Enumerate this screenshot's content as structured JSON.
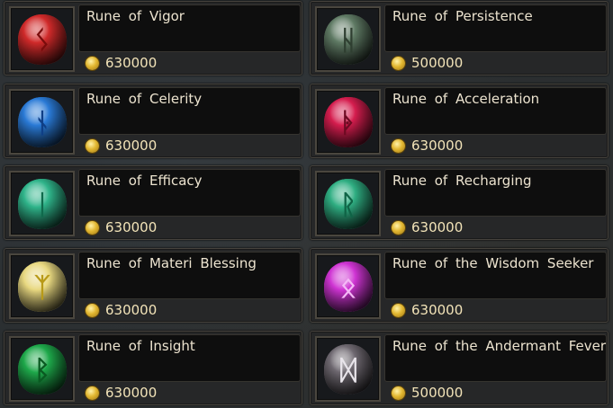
{
  "runes": [
    {
      "name": "Rune of Vigor",
      "price": "630000",
      "color": "#d02a2a",
      "glyph": "ᛊ",
      "glyph_color": "#7a0c0c"
    },
    {
      "name": "Rune of Persistence",
      "price": "500000",
      "color": "#5f7a64",
      "glyph": "ᚺ",
      "glyph_color": "#2f3f31"
    },
    {
      "name": "Rune of Celerity",
      "price": "630000",
      "color": "#2a7ad6",
      "glyph": "ᚾ",
      "glyph_color": "#0f3f86"
    },
    {
      "name": "Rune of Acceleration",
      "price": "630000",
      "color": "#d51d4e",
      "glyph": "ᚧ",
      "glyph_color": "#6d0a22"
    },
    {
      "name": "Rune of Efficacy",
      "price": "630000",
      "color": "#2fb48a",
      "glyph": "ᛁ",
      "glyph_color": "#0f6a4c"
    },
    {
      "name": "Rune of Recharging",
      "price": "630000",
      "color": "#2fae82",
      "glyph": "ᚱ",
      "glyph_color": "#0f6446"
    },
    {
      "name": "Rune of Materi Blessing",
      "price": "630000",
      "color": "#e8d880",
      "glyph": "ᛉ",
      "glyph_color": "#b89a18"
    },
    {
      "name": "Rune of the Wisdom Seeker",
      "price": "630000",
      "color": "#cf34d3",
      "glyph": "ᛟ",
      "glyph_color": "#f4b8f6"
    },
    {
      "name": "Rune of Insight",
      "price": "630000",
      "color": "#1ea84a",
      "glyph": "ᛒ",
      "glyph_color": "#0a5a22"
    },
    {
      "name": "Rune of the Andermant Fever",
      "price": "500000",
      "color": "#6e6870",
      "glyph": "ᛞ",
      "glyph_color": "#e8e4ea"
    }
  ]
}
